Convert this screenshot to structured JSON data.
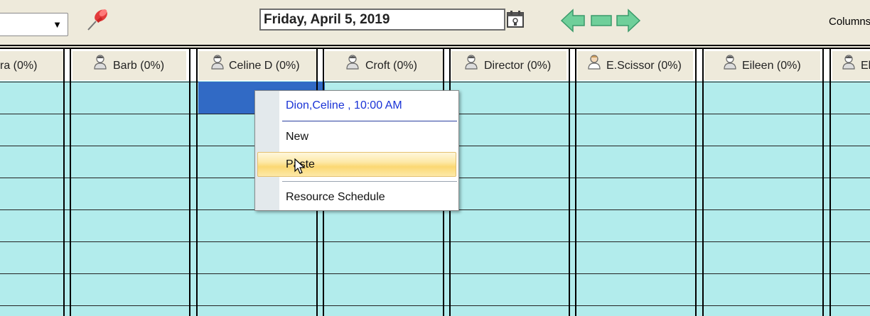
{
  "toolbar": {
    "date_label": "Friday, April 5, 2019",
    "columns_label": "Columns"
  },
  "resources": [
    {
      "name": "ra (0%)"
    },
    {
      "name": "Barb (0%)"
    },
    {
      "name": "Celine D (0%)"
    },
    {
      "name": "Croft (0%)"
    },
    {
      "name": "Director (0%)"
    },
    {
      "name": "E.Scissor (0%)"
    },
    {
      "name": "Eileen (0%)"
    },
    {
      "name": "El"
    }
  ],
  "context_menu": {
    "appointment": "Dion,Celine , 10:00 AM",
    "items": [
      {
        "label": "New"
      },
      {
        "label": "Paste",
        "hovered": true
      },
      {
        "label": "Resource Schedule"
      }
    ]
  },
  "colors": {
    "grid": "#b2ecec",
    "selected_cell": "#316ac5",
    "header_bg": "#eeeadb",
    "appointment_text": "#1a33d6"
  },
  "icons": [
    "chevron-down-icon",
    "pin-icon",
    "calendar-icon",
    "arrow-left-icon",
    "today-icon",
    "arrow-right-icon",
    "person-icon"
  ]
}
